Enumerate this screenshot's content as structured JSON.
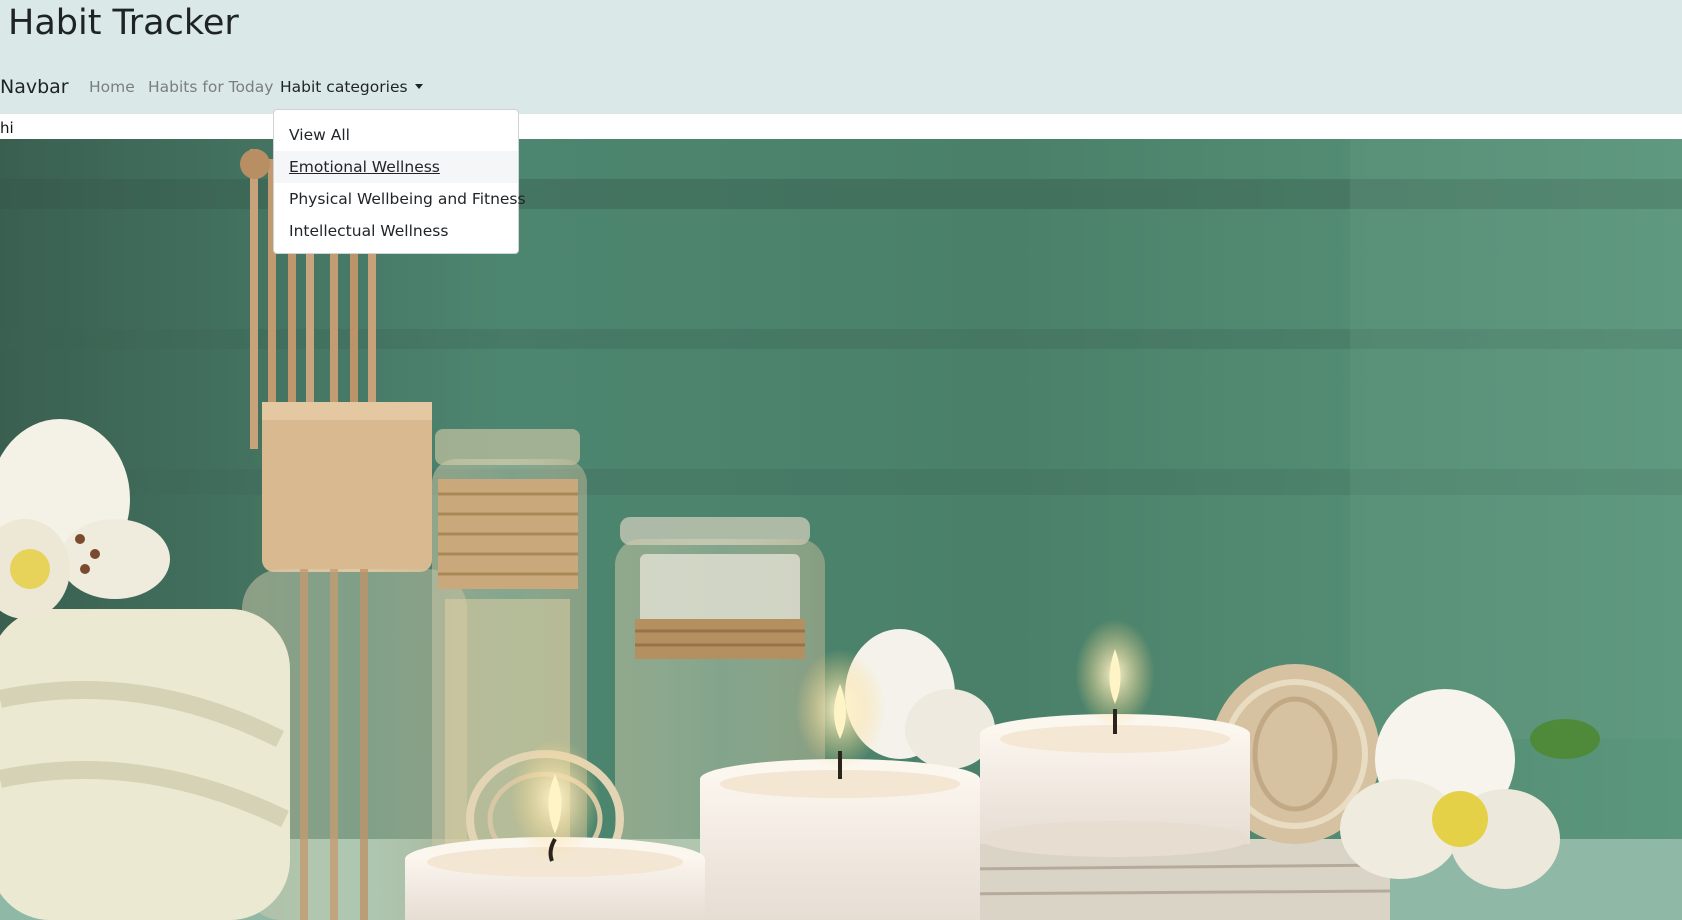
{
  "header": {
    "title": "Habit Tracker",
    "background_color": "#dae8e8"
  },
  "navbar": {
    "brand": "Navbar",
    "links": {
      "home": "Home",
      "habits_today": "Habits for Today",
      "categories": "Habit categories"
    }
  },
  "dropdown": {
    "items": [
      {
        "label": "View All"
      },
      {
        "label": "Emotional Wellness",
        "hovered": true
      },
      {
        "label": "Physical Wellbeing and Fitness"
      },
      {
        "label": "Intellectual Wellness"
      }
    ]
  },
  "content": {
    "text": "hi"
  },
  "hero": {
    "subject": "spa still life: reed diffuser, glass jars with twine, lit tealight candles, white lilies, rolled towel, wicker balls against green wooden wall"
  }
}
